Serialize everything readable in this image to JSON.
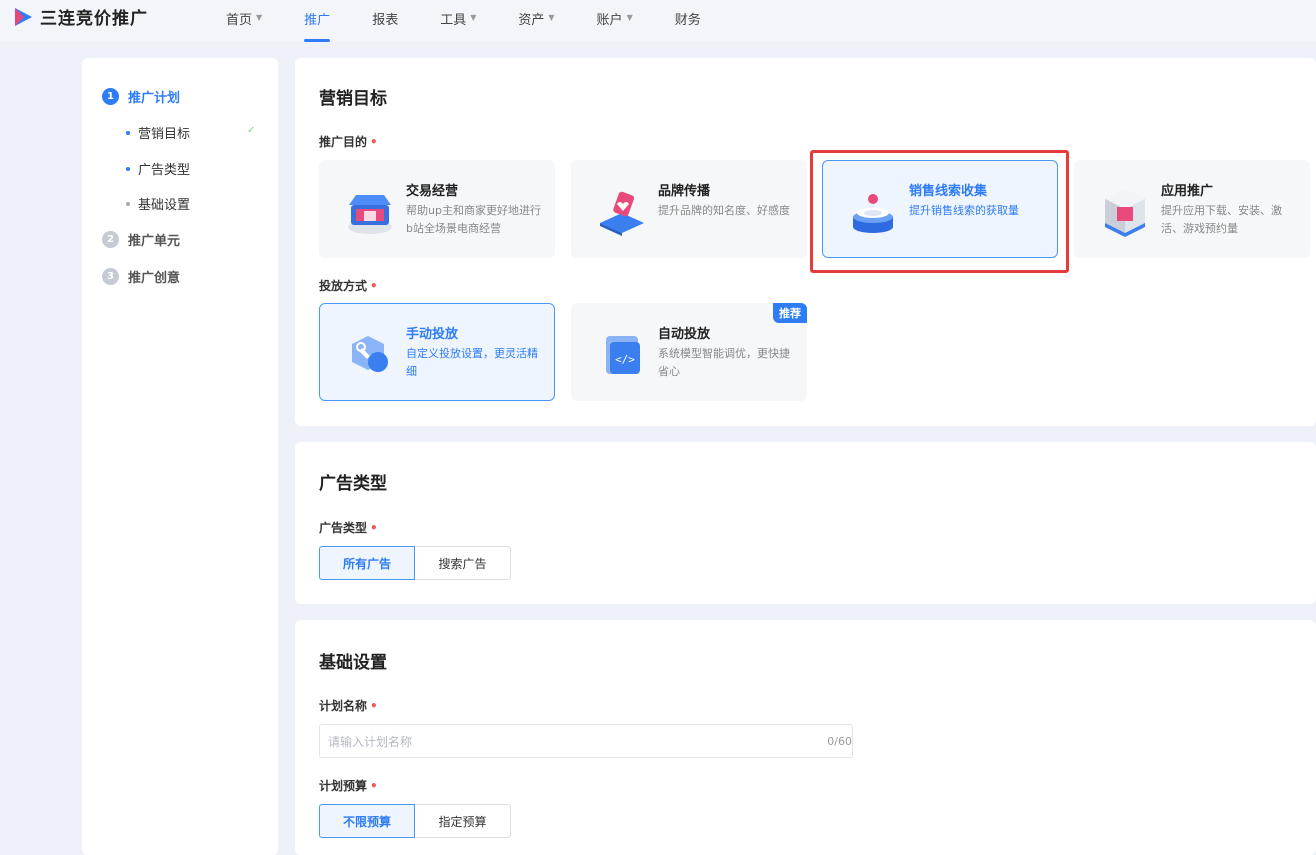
{
  "brand": {
    "name": "三连竞价推广",
    "color": "#2e7cf6"
  },
  "nav": [
    {
      "label": "首页",
      "has_dropdown": true,
      "active": false
    },
    {
      "label": "推广",
      "has_dropdown": false,
      "active": true
    },
    {
      "label": "报表",
      "has_dropdown": false,
      "active": false
    },
    {
      "label": "工具",
      "has_dropdown": true,
      "active": false
    },
    {
      "label": "资产",
      "has_dropdown": true,
      "active": false
    },
    {
      "label": "账户",
      "has_dropdown": true,
      "active": false
    },
    {
      "label": "财务",
      "has_dropdown": false,
      "active": false
    }
  ],
  "steps": [
    {
      "num": "1",
      "label": "推广计划",
      "active": true,
      "children": [
        "营销目标",
        "广告类型",
        "基础设置"
      ]
    },
    {
      "num": "2",
      "label": "推广单元",
      "active": false
    },
    {
      "num": "3",
      "label": "推广创意",
      "active": false
    }
  ],
  "marketing": {
    "title": "营销目标",
    "purpose_label": "推广目的",
    "purposes": [
      {
        "title": "交易经营",
        "desc": "帮助up主和商家更好地进行b站全场景电商经营",
        "icon": "shop-icon",
        "selected": false
      },
      {
        "title": "品牌传播",
        "desc": "提升品牌的知名度、好感度",
        "icon": "brand-heart-icon",
        "selected": false
      },
      {
        "title": "销售线索收集",
        "desc": "提升销售线索的获取量",
        "icon": "leads-stack-icon",
        "selected": true
      },
      {
        "title": "应用推广",
        "desc": "提升应用下载、安装、激活、游戏预约量",
        "icon": "app-cube-icon",
        "selected": false
      }
    ],
    "delivery_label": "投放方式",
    "delivery": [
      {
        "title": "手动投放",
        "desc": "自定义投放设置，更灵活精细",
        "icon": "wrench-icon",
        "selected": true,
        "badge": ""
      },
      {
        "title": "自动投放",
        "desc": "系统模型智能调优，更快捷省心",
        "icon": "code-window-icon",
        "selected": false,
        "badge": "推荐"
      }
    ]
  },
  "ad_type": {
    "title": "广告类型",
    "label": "广告类型",
    "options": [
      "所有广告",
      "搜索广告"
    ],
    "selected": "所有广告"
  },
  "basic": {
    "title": "基础设置",
    "name_label": "计划名称",
    "name_placeholder": "请输入计划名称",
    "name_counter": "0/60",
    "budget_label": "计划预算",
    "budget_options": [
      "不限预算",
      "指定预算"
    ],
    "budget_selected": "不限预算"
  },
  "colors": {
    "accent": "#2e7cf6",
    "required": "#f25c5c",
    "highlight": "#e63b3b"
  }
}
